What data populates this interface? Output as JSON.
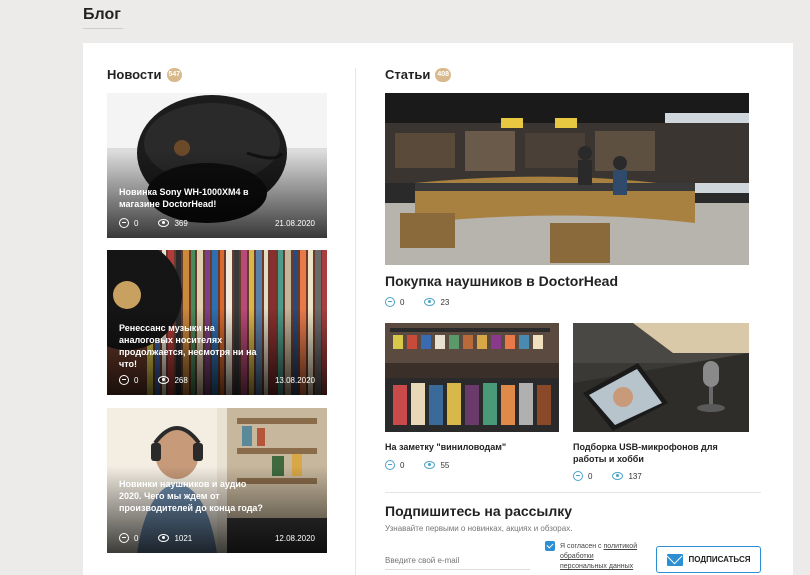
{
  "page": {
    "title": "Блог"
  },
  "news": {
    "heading": "Новости",
    "count": "547",
    "items": [
      {
        "title": "Новинка Sony WH-1000XM4 в магазине DoctorHead!",
        "comments": "0",
        "views": "369",
        "date": "21.08.2020"
      },
      {
        "title": "Ренессанс музыки на аналоговых носителях продолжается, несмотря ни на что!",
        "comments": "0",
        "views": "268",
        "date": "13.08.2020"
      },
      {
        "title": "Новинки наушников и аудио 2020. Чего мы ждем от производителей до конца года?",
        "comments": "0",
        "views": "1021",
        "date": "12.08.2020"
      }
    ]
  },
  "articles": {
    "heading": "Статьи",
    "count": "408",
    "main": {
      "title": "Покупка наушников в DoctorHead",
      "comments": "0",
      "views": "23"
    },
    "small": [
      {
        "title": "На заметку \"виниловодам\"",
        "comments": "0",
        "views": "55"
      },
      {
        "title": "Подборка USB-микрофонов для работы и хобби",
        "comments": "0",
        "views": "137"
      }
    ]
  },
  "subscribe": {
    "title": "Подпишитесь на рассылку",
    "subtitle": "Узнавайте первыми о новинках, акциях и обзорах.",
    "email_placeholder": "Введите свой e-mail",
    "agree_prefix": "Я согласен с",
    "agree_link": "политикой обработки персональных данных",
    "button_label": "ПОДПИСАТЬСЯ"
  },
  "colors": {
    "accent": "#2d8fd3",
    "badge": "#d9b98c",
    "icon": "#4aa3c9"
  }
}
